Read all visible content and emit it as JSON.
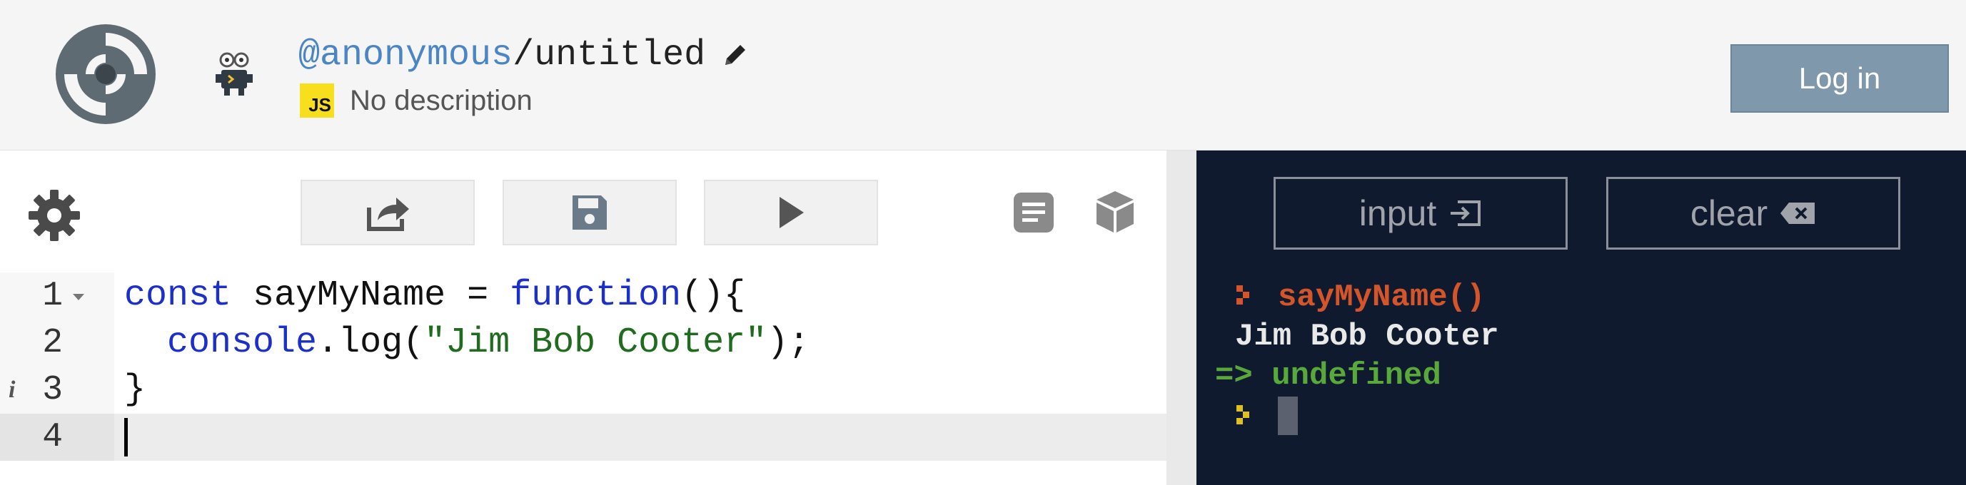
{
  "header": {
    "username": "@anonymous",
    "separator": "/",
    "project_name": "untitled",
    "language_badge": "JS",
    "description": "No description",
    "login_label": "Log in"
  },
  "editor": {
    "toolbar": [
      "settings-icon",
      "share-icon",
      "save-icon",
      "run-icon",
      "docs-icon",
      "packages-icon"
    ],
    "lines": [
      {
        "number": "1",
        "code": "const sayMyName = function(){"
      },
      {
        "number": "2",
        "code": "  console.log(\"Jim Bob Cooter\");"
      },
      {
        "number": "3",
        "code": "}"
      },
      {
        "number": "4",
        "code": ""
      }
    ],
    "tokens": {
      "l1_kw1": "const",
      "l1_ident": " sayMyName = ",
      "l1_kw2": "function",
      "l1_rest": "(){",
      "l2_indent": "  ",
      "l2_obj": "console",
      "l2_dot": ".",
      "l2_method": "log",
      "l2_open": "(",
      "l2_str": "\"Jim Bob Cooter\"",
      "l2_close": ");",
      "l3": "}"
    },
    "info_marker": "i"
  },
  "console": {
    "input_label": "input",
    "clear_label": "clear",
    "entries": [
      {
        "type": "command",
        "prefix": "",
        "text": "sayMyName()"
      },
      {
        "type": "output",
        "prefix": "",
        "text": "Jim Bob Cooter"
      },
      {
        "type": "return",
        "prefix": "=>",
        "text": "undefined"
      }
    ]
  },
  "colors": {
    "accent_blue": "#4a86c5",
    "login_bg": "#7f98ab",
    "console_bg": "#101a2e",
    "command": "#d5552a",
    "return": "#58a83a",
    "keyword": "#1c2fc9",
    "string": "#1f6b1f"
  }
}
